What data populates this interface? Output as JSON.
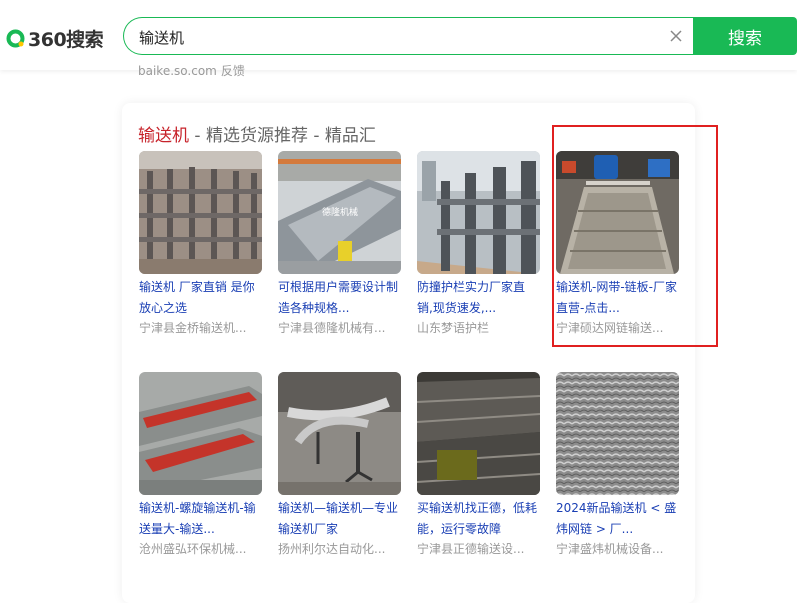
{
  "logo": {
    "text": "360搜索",
    "brand_color": "#19b955"
  },
  "search": {
    "query": "输送机",
    "button_label": "搜索"
  },
  "source": {
    "domain": "baike.so.com",
    "feedback": "反馈"
  },
  "card": {
    "title_keyword": "输送机",
    "title_rest": " - 精选货源推荐 - 精品汇",
    "items": [
      {
        "title": "输送机 厂家直销 是你放心之选",
        "source": "宁津县金桥输送机..."
      },
      {
        "title": "可根据用户需要设计制造各种规格...",
        "source": "宁津县德隆机械有...",
        "thumb_text": "德隆机械"
      },
      {
        "title": "防撞护栏实力厂家直销,现货速发,...",
        "source": "山东梦语护栏"
      },
      {
        "title": "输送机-网带-链板-厂家直营-点击...",
        "source": "宁津硕达网链输送..."
      },
      {
        "title": "输送机-螺旋输送机-输送量大-输送...",
        "source": "沧州盛弘环保机械..."
      },
      {
        "title": "输送机—输送机—专业输送机厂家",
        "source": "扬州利尔达自动化..."
      },
      {
        "title": "买输送机找正德，低耗能，运行零故障",
        "source": "宁津县正德输送设..."
      },
      {
        "title": "2024新品输送机 < 盛炜网链 > 厂...",
        "source": "宁津盛炜机械设备..."
      }
    ]
  },
  "colors": {
    "keyword_red": "#c7232b",
    "link_blue": "#1a3fb4",
    "highlight_red": "#e02020"
  }
}
